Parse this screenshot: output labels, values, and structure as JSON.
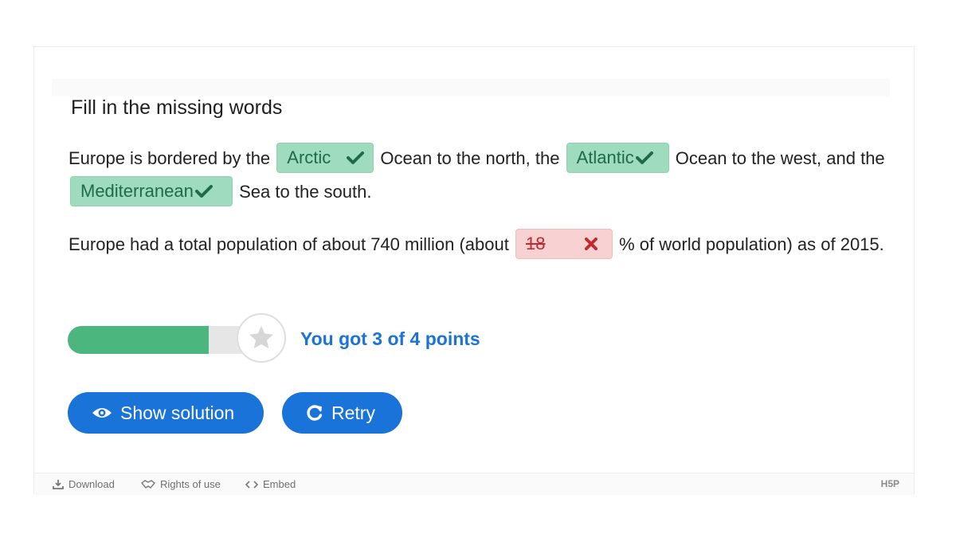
{
  "title": "Fill in the missing words",
  "paragraph1": {
    "t1": "Europe is bordered by the",
    "blank1": "Arctic",
    "t2": "Ocean to the north, the",
    "blank2": "Atlantic",
    "t3": "Ocean to the west, and the",
    "blank3": "Mediterranean",
    "t4": "Sea to the south."
  },
  "paragraph2": {
    "t1": "Europe had a total population of about 740 million (about",
    "blank1": "18",
    "t2": "% of world population) as of 2015."
  },
  "progress": {
    "score": 3,
    "max": 4,
    "fraction": 0.75
  },
  "score_text": "You got 3 of 4 points",
  "buttons": {
    "show_solution": "Show solution",
    "retry": "Retry"
  },
  "footer": {
    "download": "Download",
    "rights": "Rights of use",
    "embed": "Embed",
    "brand": "H5P"
  },
  "colors": {
    "correct_bg": "#9fdcbe",
    "wrong_bg": "#f8d2d3",
    "primary": "#1a73d9",
    "progress": "#4bb67d",
    "correct_mark": "#1f6a47",
    "wrong_mark": "#c12a2f"
  }
}
